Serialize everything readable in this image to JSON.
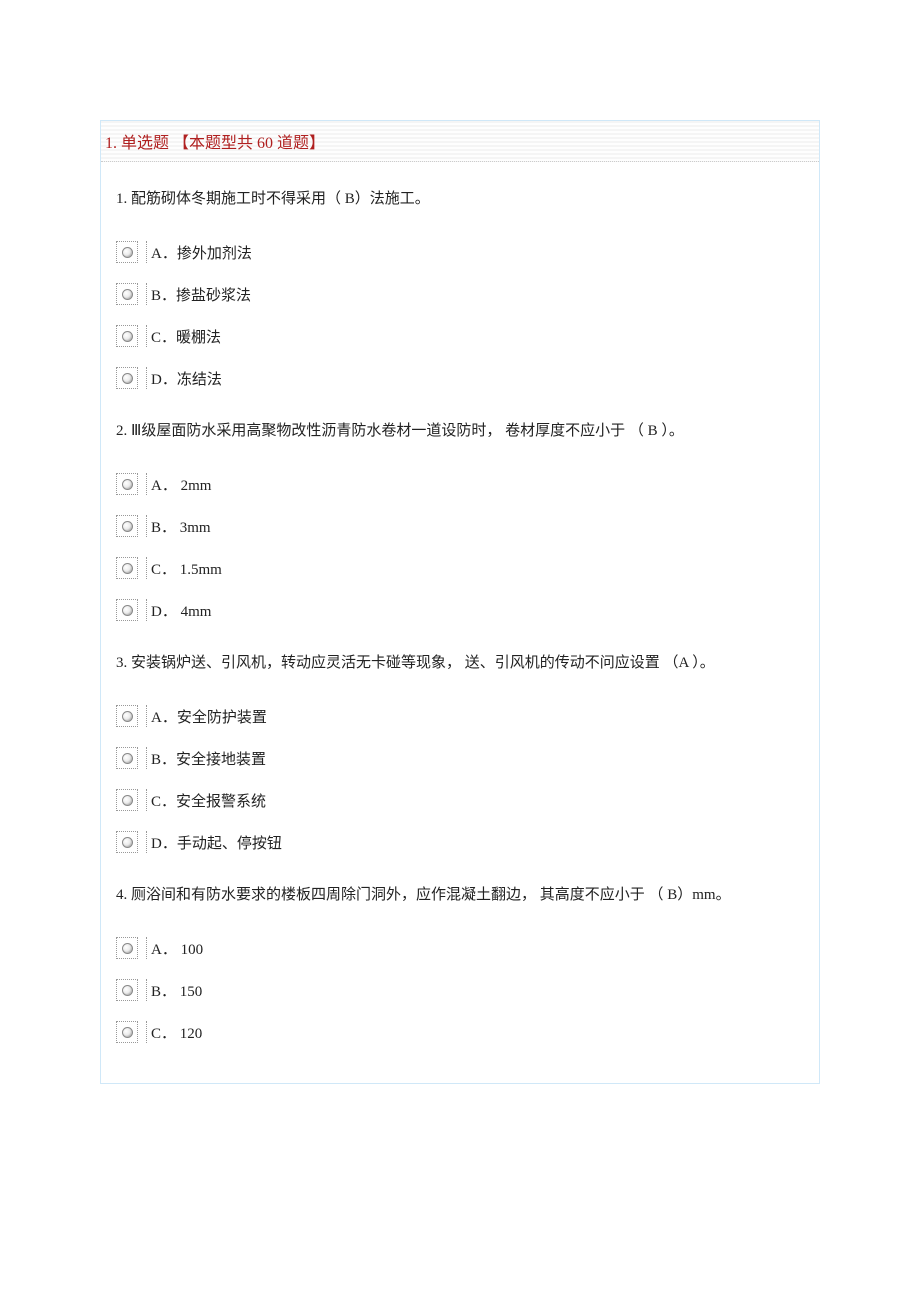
{
  "section": {
    "header": "1. 单选题  【本题型共 60 道题】"
  },
  "questions": [
    {
      "text": "1. 配筋砌体冬期施工时不得采用（        B）法施工。",
      "options": [
        "A．掺外加剂法",
        "B．掺盐砂浆法",
        "C．暖棚法",
        "D．冻结法"
      ]
    },
    {
      "text": "2. Ⅲ级屋面防水采用高聚物改性沥青防水卷材一道设防时，        卷材厚度不应小于  （ B  ）。",
      "options": [
        "A． 2mm",
        "B． 3mm",
        "C． 1.5mm",
        "D． 4mm"
      ]
    },
    {
      "text": "3. 安装锅炉送、引风机，转动应灵活无卡碰等现象，    送、引风机的传动不问应设置    （A  ）。",
      "options": [
        "A．安全防护装置",
        "B．安全接地装置",
        "C．安全报警系统",
        "D．手动起、停按钮"
      ]
    },
    {
      "text": "4. 厕浴间和有防水要求的楼板四周除门洞外，应作混凝土翻边，    其高度不应小于  （     B）mm。",
      "options": [
        "A． 100",
        "B． 150",
        "C． 120"
      ]
    }
  ]
}
